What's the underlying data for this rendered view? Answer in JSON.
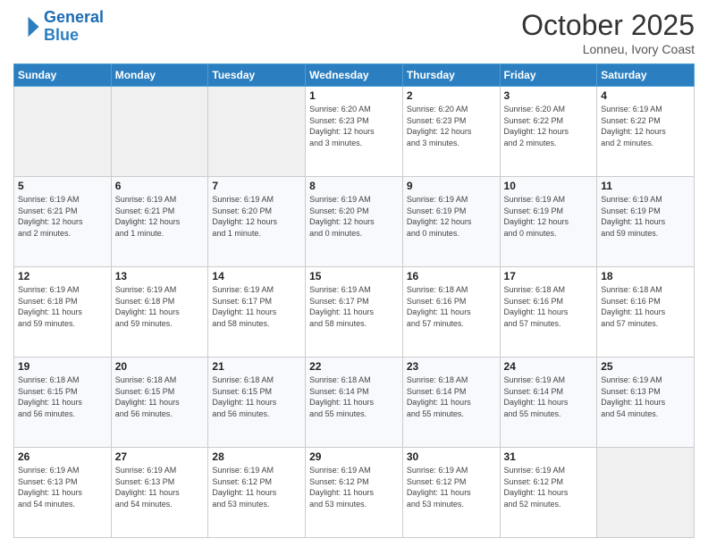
{
  "header": {
    "logo_line1": "General",
    "logo_line2": "Blue",
    "month": "October 2025",
    "location": "Lonneu, Ivory Coast"
  },
  "weekdays": [
    "Sunday",
    "Monday",
    "Tuesday",
    "Wednesday",
    "Thursday",
    "Friday",
    "Saturday"
  ],
  "weeks": [
    [
      {
        "day": "",
        "info": ""
      },
      {
        "day": "",
        "info": ""
      },
      {
        "day": "",
        "info": ""
      },
      {
        "day": "1",
        "info": "Sunrise: 6:20 AM\nSunset: 6:23 PM\nDaylight: 12 hours\nand 3 minutes."
      },
      {
        "day": "2",
        "info": "Sunrise: 6:20 AM\nSunset: 6:23 PM\nDaylight: 12 hours\nand 3 minutes."
      },
      {
        "day": "3",
        "info": "Sunrise: 6:20 AM\nSunset: 6:22 PM\nDaylight: 12 hours\nand 2 minutes."
      },
      {
        "day": "4",
        "info": "Sunrise: 6:19 AM\nSunset: 6:22 PM\nDaylight: 12 hours\nand 2 minutes."
      }
    ],
    [
      {
        "day": "5",
        "info": "Sunrise: 6:19 AM\nSunset: 6:21 PM\nDaylight: 12 hours\nand 2 minutes."
      },
      {
        "day": "6",
        "info": "Sunrise: 6:19 AM\nSunset: 6:21 PM\nDaylight: 12 hours\nand 1 minute."
      },
      {
        "day": "7",
        "info": "Sunrise: 6:19 AM\nSunset: 6:20 PM\nDaylight: 12 hours\nand 1 minute."
      },
      {
        "day": "8",
        "info": "Sunrise: 6:19 AM\nSunset: 6:20 PM\nDaylight: 12 hours\nand 0 minutes."
      },
      {
        "day": "9",
        "info": "Sunrise: 6:19 AM\nSunset: 6:19 PM\nDaylight: 12 hours\nand 0 minutes."
      },
      {
        "day": "10",
        "info": "Sunrise: 6:19 AM\nSunset: 6:19 PM\nDaylight: 12 hours\nand 0 minutes."
      },
      {
        "day": "11",
        "info": "Sunrise: 6:19 AM\nSunset: 6:19 PM\nDaylight: 11 hours\nand 59 minutes."
      }
    ],
    [
      {
        "day": "12",
        "info": "Sunrise: 6:19 AM\nSunset: 6:18 PM\nDaylight: 11 hours\nand 59 minutes."
      },
      {
        "day": "13",
        "info": "Sunrise: 6:19 AM\nSunset: 6:18 PM\nDaylight: 11 hours\nand 59 minutes."
      },
      {
        "day": "14",
        "info": "Sunrise: 6:19 AM\nSunset: 6:17 PM\nDaylight: 11 hours\nand 58 minutes."
      },
      {
        "day": "15",
        "info": "Sunrise: 6:19 AM\nSunset: 6:17 PM\nDaylight: 11 hours\nand 58 minutes."
      },
      {
        "day": "16",
        "info": "Sunrise: 6:18 AM\nSunset: 6:16 PM\nDaylight: 11 hours\nand 57 minutes."
      },
      {
        "day": "17",
        "info": "Sunrise: 6:18 AM\nSunset: 6:16 PM\nDaylight: 11 hours\nand 57 minutes."
      },
      {
        "day": "18",
        "info": "Sunrise: 6:18 AM\nSunset: 6:16 PM\nDaylight: 11 hours\nand 57 minutes."
      }
    ],
    [
      {
        "day": "19",
        "info": "Sunrise: 6:18 AM\nSunset: 6:15 PM\nDaylight: 11 hours\nand 56 minutes."
      },
      {
        "day": "20",
        "info": "Sunrise: 6:18 AM\nSunset: 6:15 PM\nDaylight: 11 hours\nand 56 minutes."
      },
      {
        "day": "21",
        "info": "Sunrise: 6:18 AM\nSunset: 6:15 PM\nDaylight: 11 hours\nand 56 minutes."
      },
      {
        "day": "22",
        "info": "Sunrise: 6:18 AM\nSunset: 6:14 PM\nDaylight: 11 hours\nand 55 minutes."
      },
      {
        "day": "23",
        "info": "Sunrise: 6:18 AM\nSunset: 6:14 PM\nDaylight: 11 hours\nand 55 minutes."
      },
      {
        "day": "24",
        "info": "Sunrise: 6:19 AM\nSunset: 6:14 PM\nDaylight: 11 hours\nand 55 minutes."
      },
      {
        "day": "25",
        "info": "Sunrise: 6:19 AM\nSunset: 6:13 PM\nDaylight: 11 hours\nand 54 minutes."
      }
    ],
    [
      {
        "day": "26",
        "info": "Sunrise: 6:19 AM\nSunset: 6:13 PM\nDaylight: 11 hours\nand 54 minutes."
      },
      {
        "day": "27",
        "info": "Sunrise: 6:19 AM\nSunset: 6:13 PM\nDaylight: 11 hours\nand 54 minutes."
      },
      {
        "day": "28",
        "info": "Sunrise: 6:19 AM\nSunset: 6:12 PM\nDaylight: 11 hours\nand 53 minutes."
      },
      {
        "day": "29",
        "info": "Sunrise: 6:19 AM\nSunset: 6:12 PM\nDaylight: 11 hours\nand 53 minutes."
      },
      {
        "day": "30",
        "info": "Sunrise: 6:19 AM\nSunset: 6:12 PM\nDaylight: 11 hours\nand 53 minutes."
      },
      {
        "day": "31",
        "info": "Sunrise: 6:19 AM\nSunset: 6:12 PM\nDaylight: 11 hours\nand 52 minutes."
      },
      {
        "day": "",
        "info": ""
      }
    ]
  ]
}
